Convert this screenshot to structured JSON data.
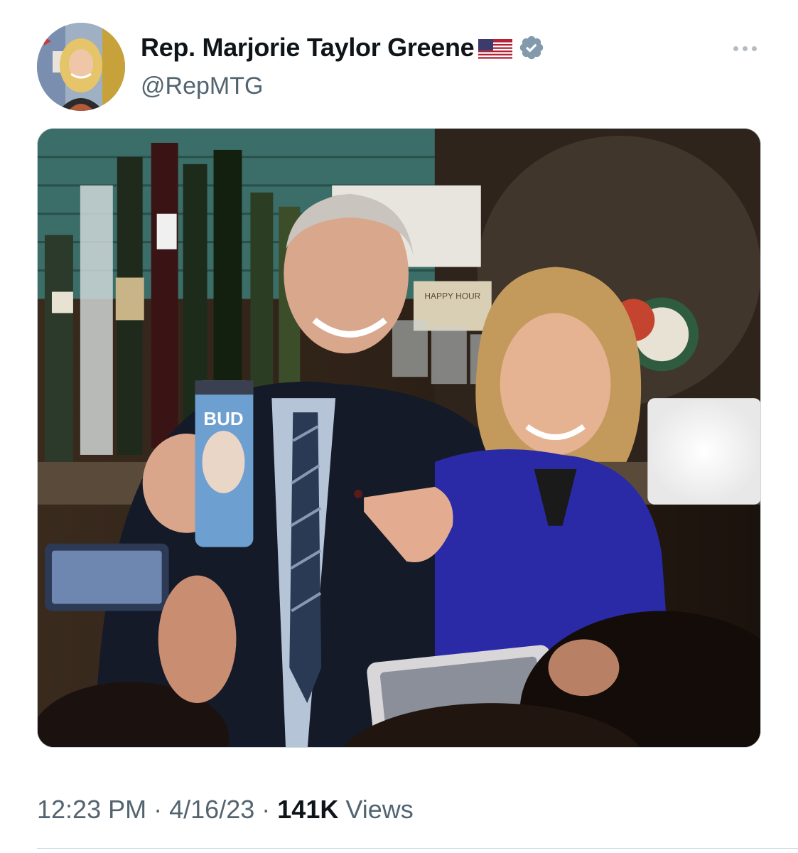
{
  "author": {
    "display_name": "Rep. Marjorie Taylor Greene",
    "handle": "@RepMTG",
    "flag_icon": "us-flag-icon",
    "verified_icon": "verified-badge-icon",
    "verified_color": "#829aab"
  },
  "menu": {
    "more_icon": "more-dots-icon"
  },
  "media": {
    "photo_text": {
      "can_label": "BUD",
      "sign_label": "HAPPY HOUR"
    }
  },
  "meta": {
    "time": "12:23 PM",
    "separator": "·",
    "date": "4/16/23",
    "views_count": "141K",
    "views_label": "Views"
  },
  "colors": {
    "text_primary": "#0f1419",
    "text_secondary": "#536471",
    "border": "#cfd9de"
  }
}
